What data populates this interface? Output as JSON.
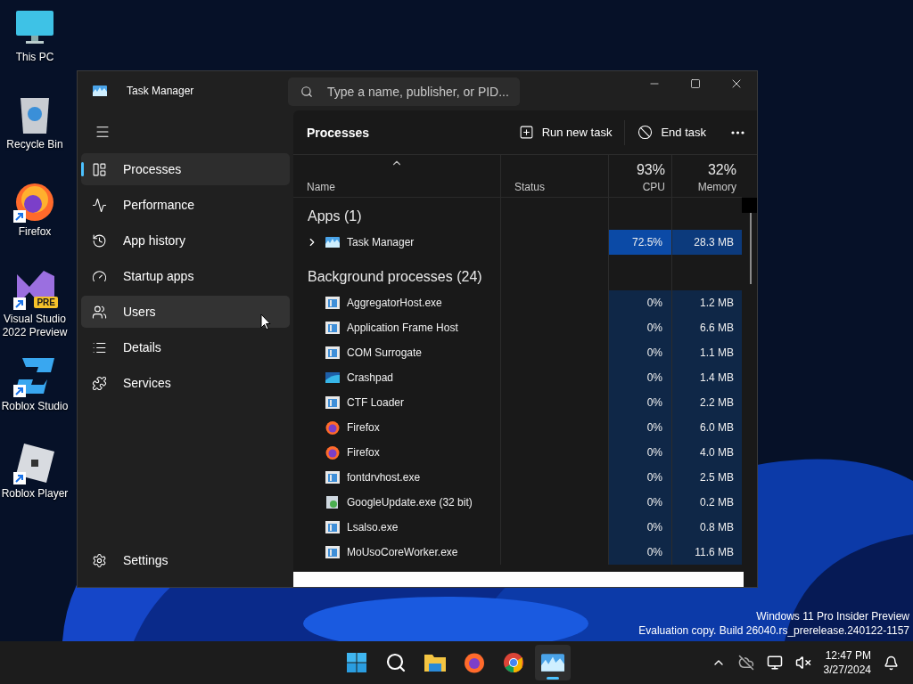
{
  "desktop_icons": [
    {
      "kind": "computer",
      "label": "This PC",
      "shortcut": false
    },
    {
      "kind": "recycle_bin",
      "label": "Recycle Bin",
      "shortcut": false
    },
    {
      "kind": "firefox",
      "label": "Firefox",
      "shortcut": true
    },
    {
      "kind": "visual_studio",
      "label": "Visual Studio 2022 Preview",
      "badge": "PRE",
      "shortcut": true
    },
    {
      "kind": "roblox_studio",
      "label": "Roblox Studio",
      "shortcut": true
    },
    {
      "kind": "roblox_player",
      "label": "Roblox Player",
      "shortcut": true
    }
  ],
  "window": {
    "title": "Task Manager",
    "search": {
      "placeholder": "Type a name, publisher, or PID..."
    }
  },
  "sidebar": {
    "items": [
      {
        "label": "Processes",
        "selected": true,
        "hovered": false
      },
      {
        "label": "Performance",
        "selected": false,
        "hovered": false
      },
      {
        "label": "App history",
        "selected": false,
        "hovered": false
      },
      {
        "label": "Startup apps",
        "selected": false,
        "hovered": false
      },
      {
        "label": "Users",
        "selected": false,
        "hovered": true
      },
      {
        "label": "Details",
        "selected": false,
        "hovered": false
      },
      {
        "label": "Services",
        "selected": false,
        "hovered": false
      }
    ],
    "settings": "Settings"
  },
  "page": {
    "title": "Processes",
    "actions": [
      {
        "kind": "run",
        "label": "Run new task"
      },
      {
        "kind": "end",
        "label": "End task"
      }
    ]
  },
  "table": {
    "columns": [
      {
        "label": "Name",
        "sorted": true
      },
      {
        "label": "Status",
        "sorted": false
      },
      {
        "label": "CPU",
        "total": "93%",
        "sorted": false
      },
      {
        "label": "Memory",
        "total": "32%",
        "sorted": false
      }
    ],
    "groups": [
      {
        "kind": "apps",
        "label": "Apps (1)",
        "rows": [
          {
            "kind": "taskmgr",
            "name": "Task Manager",
            "expanded": false,
            "cpu": "72.5%",
            "memory": "28.3 MB"
          }
        ]
      },
      {
        "kind": "background",
        "label": "Background processes (24)",
        "rows": [
          {
            "kind": "service",
            "name": "AggregatorHost.exe",
            "cpu": "0%",
            "memory": "1.2 MB"
          },
          {
            "kind": "service",
            "name": "Application Frame Host",
            "cpu": "0%",
            "memory": "6.6 MB"
          },
          {
            "kind": "service",
            "name": "COM Surrogate",
            "cpu": "0%",
            "memory": "1.1 MB"
          },
          {
            "kind": "crashpad",
            "name": "Crashpad",
            "cpu": "0%",
            "memory": "1.4 MB"
          },
          {
            "kind": "service",
            "name": "CTF Loader",
            "cpu": "0%",
            "memory": "2.2 MB"
          },
          {
            "kind": "firefox",
            "name": "Firefox",
            "cpu": "0%",
            "memory": "6.0 MB"
          },
          {
            "kind": "firefox",
            "name": "Firefox",
            "cpu": "0%",
            "memory": "4.0 MB"
          },
          {
            "kind": "service",
            "name": "fontdrvhost.exe",
            "cpu": "0%",
            "memory": "2.5 MB"
          },
          {
            "kind": "installer",
            "name": "GoogleUpdate.exe (32 bit)",
            "cpu": "0%",
            "memory": "0.2 MB"
          },
          {
            "kind": "service",
            "name": "Lsalso.exe",
            "cpu": "0%",
            "memory": "0.8 MB"
          },
          {
            "kind": "service",
            "name": "MoUsoCoreWorker.exe",
            "cpu": "0%",
            "memory": "11.6 MB"
          }
        ]
      }
    ]
  },
  "desktop_footer": [
    "Windows 11 Pro Insider Preview",
    "Evaluation copy. Build 26040.rs_prerelease.240122-1157"
  ],
  "taskbar": {
    "apps": [
      {
        "kind": "start",
        "active": false
      },
      {
        "kind": "search",
        "active": false
      },
      {
        "kind": "explorer",
        "active": false
      },
      {
        "kind": "firefox",
        "active": false
      },
      {
        "kind": "chrome",
        "active": false
      },
      {
        "kind": "taskmgr",
        "active": true
      }
    ],
    "clock": {
      "time": "12:47 PM",
      "date": "3/27/2024"
    }
  }
}
